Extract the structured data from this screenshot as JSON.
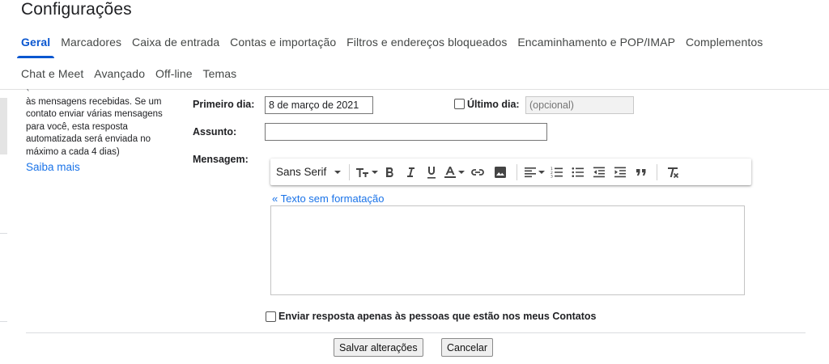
{
  "page_title": "Configurações",
  "tabs_row1": [
    {
      "label": "Geral",
      "active": true
    },
    {
      "label": "Marcadores"
    },
    {
      "label": "Caixa de entrada"
    },
    {
      "label": "Contas e importação"
    },
    {
      "label": "Filtros e endereços bloqueados"
    },
    {
      "label": "Encaminhamento e POP/IMAP"
    },
    {
      "label": "Complementos"
    }
  ],
  "tabs_row2": [
    {
      "label": "Chat e Meet"
    },
    {
      "label": "Avançado"
    },
    {
      "label": "Off-line"
    },
    {
      "label": "Temas"
    }
  ],
  "description": {
    "clipped_line": "(",
    "lines": [
      "às mensagens recebidas. Se um",
      "contato enviar várias mensagens",
      "para você, esta resposta",
      "automatizada será enviada no",
      "máximo a cada 4 dias)"
    ],
    "learn_more": "Saiba mais"
  },
  "form": {
    "first_day_label": "Primeiro dia:",
    "first_day_value": "8 de março de 2021",
    "last_day_label": "Último dia:",
    "last_day_placeholder": "(opcional)",
    "subject_label": "Assunto:",
    "subject_value": "",
    "message_label": "Mensagem:",
    "font_family": "Sans Serif",
    "plain_text_link": "« Texto sem formatação",
    "contacts_only_label": "Enviar resposta apenas às pessoas que estão nos meus Contatos"
  },
  "actions": {
    "save": "Salvar alterações",
    "cancel": "Cancelar"
  },
  "colors": {
    "accent": "#0b57d0",
    "link": "#1a73e8"
  }
}
